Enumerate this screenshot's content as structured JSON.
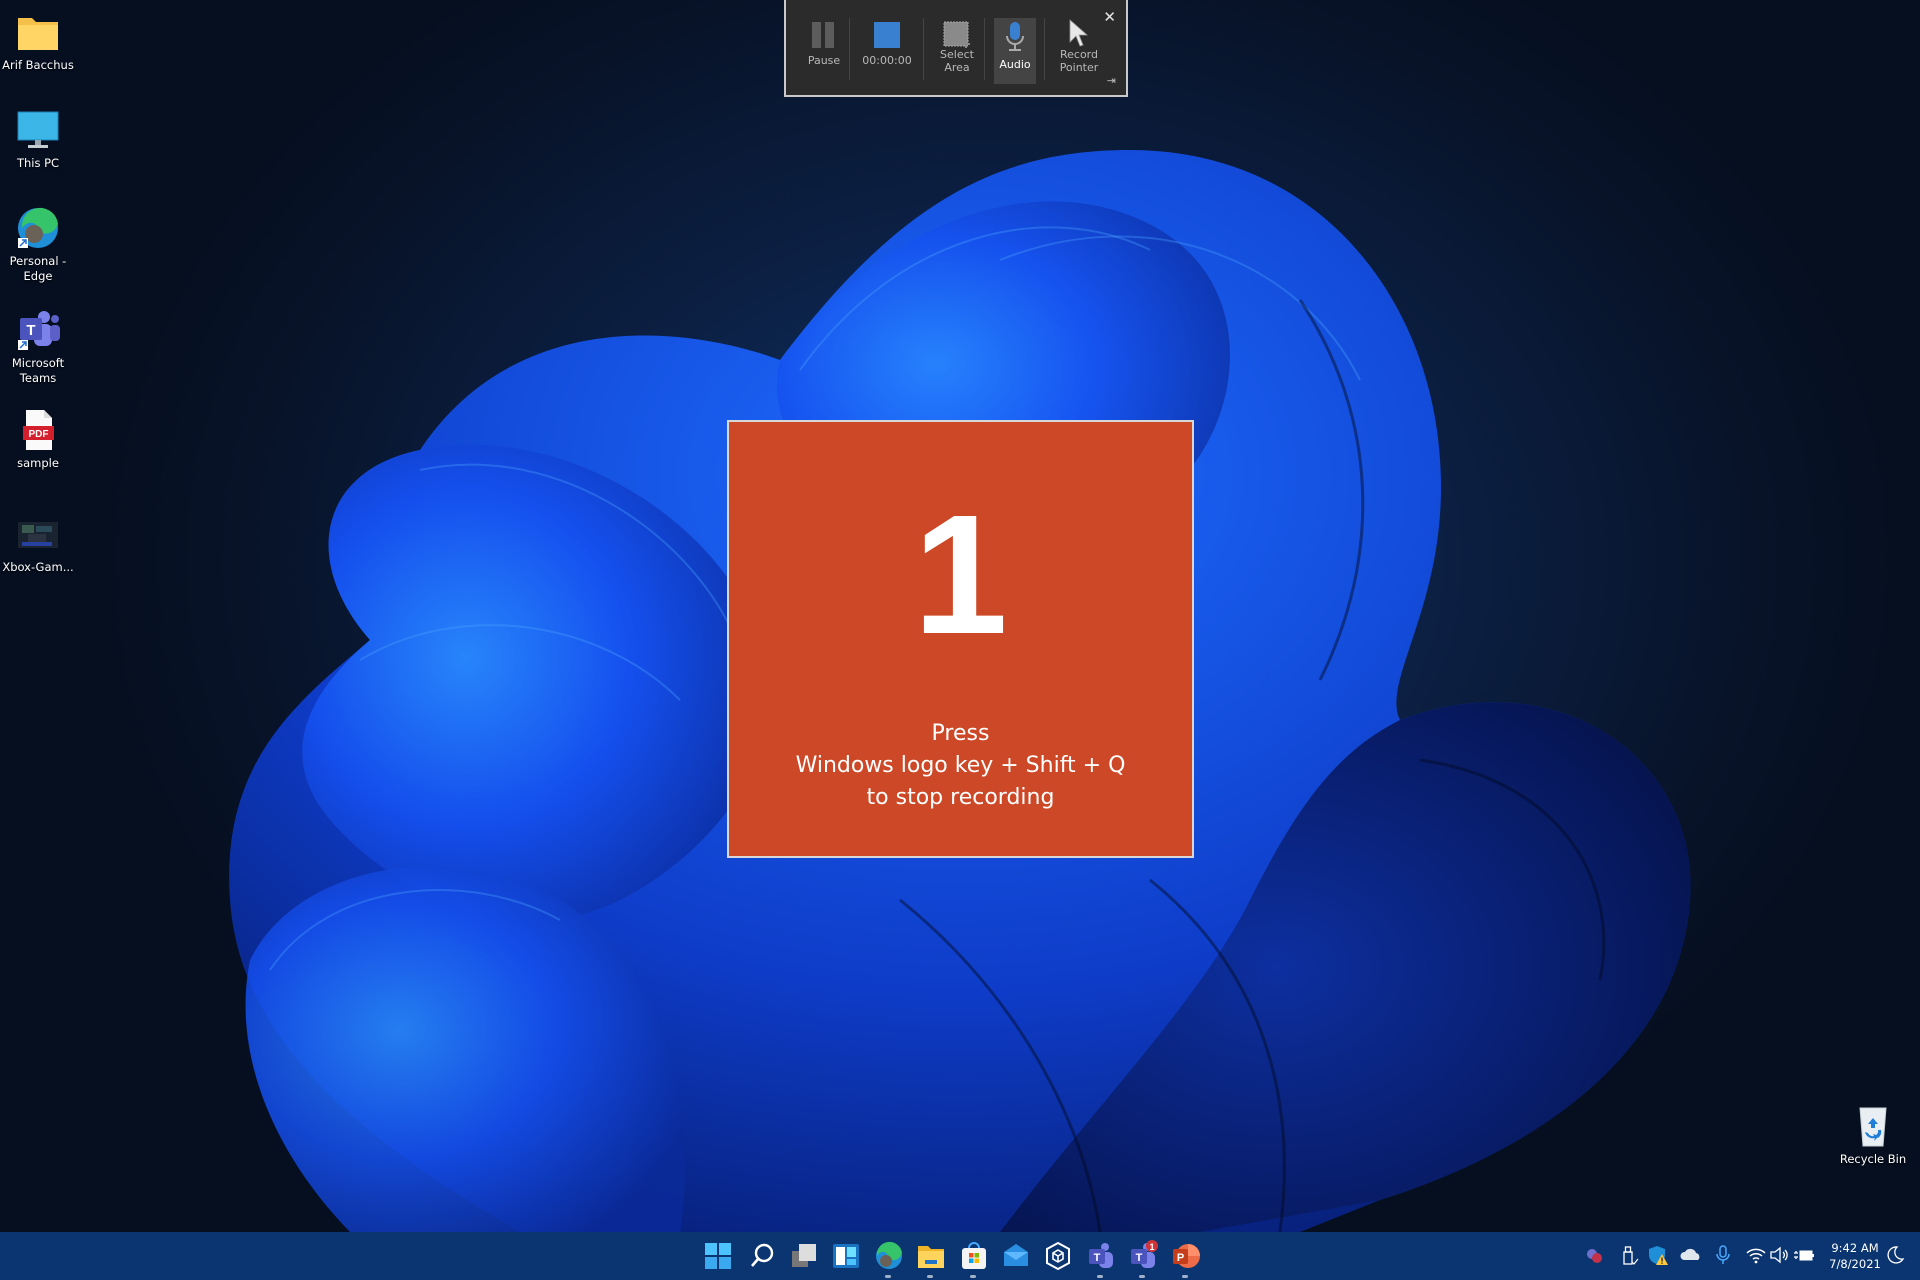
{
  "desktop": {
    "icons": [
      {
        "label": "Arif Bacchus",
        "icon": "folder-icon"
      },
      {
        "label": "This PC",
        "icon": "monitor-icon"
      },
      {
        "label": "Personal - Edge",
        "icon": "edge-icon"
      },
      {
        "label": "Microsoft Teams",
        "icon": "teams-icon"
      },
      {
        "label": "sample",
        "icon": "pdf-icon",
        "badge": "PDF"
      },
      {
        "label": "Xbox-Gam...",
        "icon": "xbox-game-thumbnail-icon"
      },
      {
        "label": "Recycle Bin",
        "icon": "recycle-bin-icon"
      }
    ]
  },
  "recorder_toolbar": {
    "pause_label": "Pause",
    "timer": "00:00:00",
    "select_area_line1": "Select",
    "select_area_line2": "Area",
    "audio_label": "Audio",
    "record_pointer_line1": "Record",
    "record_pointer_line2": "Pointer",
    "close_glyph": "✕",
    "pin_glyph": "⇥",
    "stop_color": "#3a80d0",
    "audio_active": true
  },
  "countdown": {
    "number": "1",
    "line1": "Press",
    "line2": "Windows logo key + Shift + Q",
    "line3": "to stop recording",
    "color": "#cd4826"
  },
  "taskbar": {
    "apps": [
      {
        "name": "start",
        "icon": "windows-start-icon"
      },
      {
        "name": "search",
        "icon": "search-icon"
      },
      {
        "name": "task-view",
        "icon": "task-view-icon"
      },
      {
        "name": "widgets",
        "icon": "widgets-icon"
      },
      {
        "name": "edge",
        "icon": "edge-icon",
        "running": true
      },
      {
        "name": "file-explorer",
        "icon": "folder-icon",
        "running": true
      },
      {
        "name": "microsoft-store",
        "icon": "store-icon",
        "running": true
      },
      {
        "name": "mail",
        "icon": "mail-icon"
      },
      {
        "name": "3d-viewer",
        "icon": "cube-icon"
      },
      {
        "name": "teams",
        "icon": "teams-icon",
        "running": true
      },
      {
        "name": "teams-work",
        "icon": "teams-icon",
        "running": true,
        "badge": "1"
      },
      {
        "name": "powerpoint",
        "icon": "powerpoint-icon",
        "running": true
      }
    ],
    "tray": {
      "icons": [
        "teams-chat-icon",
        "usb-eject-icon",
        "windows-security-warning-icon",
        "onedrive-icon",
        "microphone-icon",
        "wifi-icon",
        "volume-icon",
        "battery-charging-icon"
      ],
      "time": "9:42 AM",
      "date": "7/8/2021",
      "focus_icon": "moon-icon"
    }
  }
}
